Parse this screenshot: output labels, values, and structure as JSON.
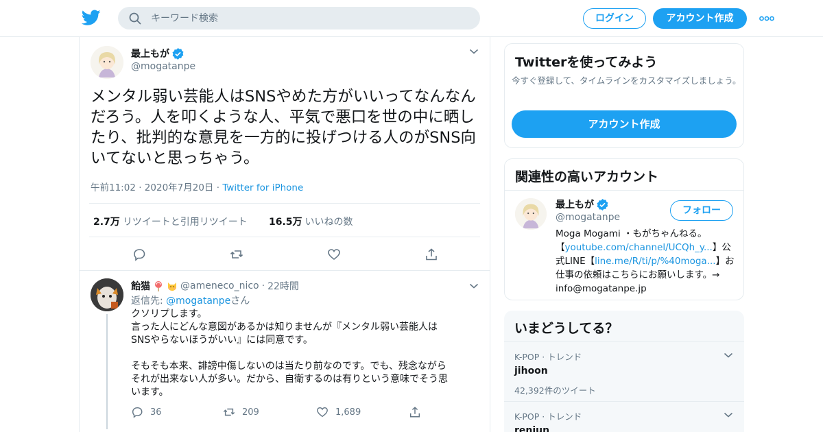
{
  "header": {
    "search_placeholder": "キーワード検索",
    "login_label": "ログイン",
    "signup_label": "アカウント作成",
    "brand_color": "#1da1f2"
  },
  "tweet": {
    "name": "最上もが",
    "handle": "@mogatanpe",
    "text": "メンタル弱い芸能人はSNSやめた方がいいってなんなんだろう。人を叩くような人、平気で悪口を世の中に晒したり、批判的な意見を一方的に投げつける人のがSNS向いてないと思っちゃう。",
    "time": "午前11:02",
    "date": "2020年7月20日",
    "source": "Twitter for iPhone",
    "retweets_count": "2.7万",
    "retweets_label": "リツイートと引用リツイート",
    "likes_count": "16.5万",
    "likes_label": "いいねの数",
    "verified": true
  },
  "reply": {
    "name": "飴猫",
    "emoji": [
      "lollipop-emoji",
      "smiling-cat-emoji"
    ],
    "handle": "@ameneco_nico",
    "time": "22時間",
    "reply_to_prefix": "返信先: ",
    "reply_to_handle": "@mogatanpe",
    "reply_to_suffix": "さん",
    "text": "クソリプします。\n言った人にどんな意図があるかは知りませんが『メンタル弱い芸能人は\nSNSやらないほうがいい』には同意です。\n\nそもそも本来、誹謗中傷しないのは当たり前なのです。でも、残念ながら\nそれが出来ない人が多い。だから、自衛するのは有りという意味でそう思\nいます。",
    "replies": "36",
    "retweets": "209",
    "likes": "1,689"
  },
  "sidebar": {
    "signup_card": {
      "title": "Twitterを使ってみよう",
      "desc": "今すぐ登録して、タイムラインをカスタマイズしましょう。",
      "button": "アカウント作成"
    },
    "related": {
      "title": "関連性の高いアカウント",
      "name": "最上もが",
      "handle": "@mogatanpe",
      "follow_label": "フォロー",
      "bio_1": "Moga Mogami ・もがちゃんねる。【",
      "bio_link_1": "youtube.com/channel/UCQh_y...",
      "bio_2": "】公式LINE【",
      "bio_link_2": "line.me/R/ti/p/%40moga...",
      "bio_3": "】お仕事の依頼はこちらにお願いします。→ info@mogatanpe.jp"
    },
    "trends": {
      "title": "いまどうしてる？",
      "items": [
        {
          "context": "K-POP · トレンド",
          "name": "jihoon",
          "count": "42,392件のツイート"
        },
        {
          "context": "K-POP · トレンド",
          "name": "renjun",
          "count": ""
        }
      ]
    }
  }
}
